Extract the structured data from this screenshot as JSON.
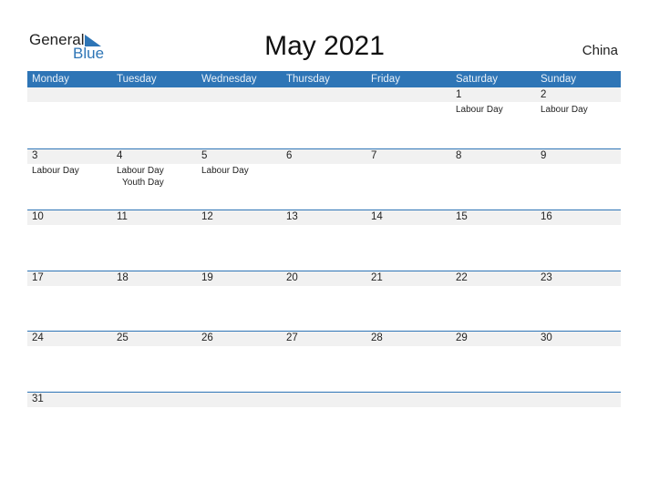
{
  "logo": {
    "general": "General",
    "blue": "Blue"
  },
  "title": "May 2021",
  "country": "China",
  "colors": {
    "accent": "#2e75b6",
    "day_bar": "#f1f1f1"
  },
  "weekdays": [
    "Monday",
    "Tuesday",
    "Wednesday",
    "Thursday",
    "Friday",
    "Saturday",
    "Sunday"
  ],
  "weeks": [
    {
      "days": [
        {
          "num": "",
          "events": []
        },
        {
          "num": "",
          "events": []
        },
        {
          "num": "",
          "events": []
        },
        {
          "num": "",
          "events": []
        },
        {
          "num": "",
          "events": []
        },
        {
          "num": "1",
          "events": [
            "Labour Day"
          ]
        },
        {
          "num": "2",
          "events": [
            "Labour Day"
          ]
        }
      ]
    },
    {
      "days": [
        {
          "num": "3",
          "events": [
            "Labour Day"
          ]
        },
        {
          "num": "4",
          "events": [
            "Labour Day",
            "Youth Day"
          ]
        },
        {
          "num": "5",
          "events": [
            "Labour Day"
          ]
        },
        {
          "num": "6",
          "events": []
        },
        {
          "num": "7",
          "events": []
        },
        {
          "num": "8",
          "events": []
        },
        {
          "num": "9",
          "events": []
        }
      ]
    },
    {
      "days": [
        {
          "num": "10",
          "events": []
        },
        {
          "num": "11",
          "events": []
        },
        {
          "num": "12",
          "events": []
        },
        {
          "num": "13",
          "events": []
        },
        {
          "num": "14",
          "events": []
        },
        {
          "num": "15",
          "events": []
        },
        {
          "num": "16",
          "events": []
        }
      ]
    },
    {
      "days": [
        {
          "num": "17",
          "events": []
        },
        {
          "num": "18",
          "events": []
        },
        {
          "num": "19",
          "events": []
        },
        {
          "num": "20",
          "events": []
        },
        {
          "num": "21",
          "events": []
        },
        {
          "num": "22",
          "events": []
        },
        {
          "num": "23",
          "events": []
        }
      ]
    },
    {
      "days": [
        {
          "num": "24",
          "events": []
        },
        {
          "num": "25",
          "events": []
        },
        {
          "num": "26",
          "events": []
        },
        {
          "num": "27",
          "events": []
        },
        {
          "num": "28",
          "events": []
        },
        {
          "num": "29",
          "events": []
        },
        {
          "num": "30",
          "events": []
        }
      ]
    },
    {
      "days": [
        {
          "num": "31",
          "events": []
        },
        {
          "num": "",
          "events": []
        },
        {
          "num": "",
          "events": []
        },
        {
          "num": "",
          "events": []
        },
        {
          "num": "",
          "events": []
        },
        {
          "num": "",
          "events": []
        },
        {
          "num": "",
          "events": []
        }
      ]
    }
  ]
}
